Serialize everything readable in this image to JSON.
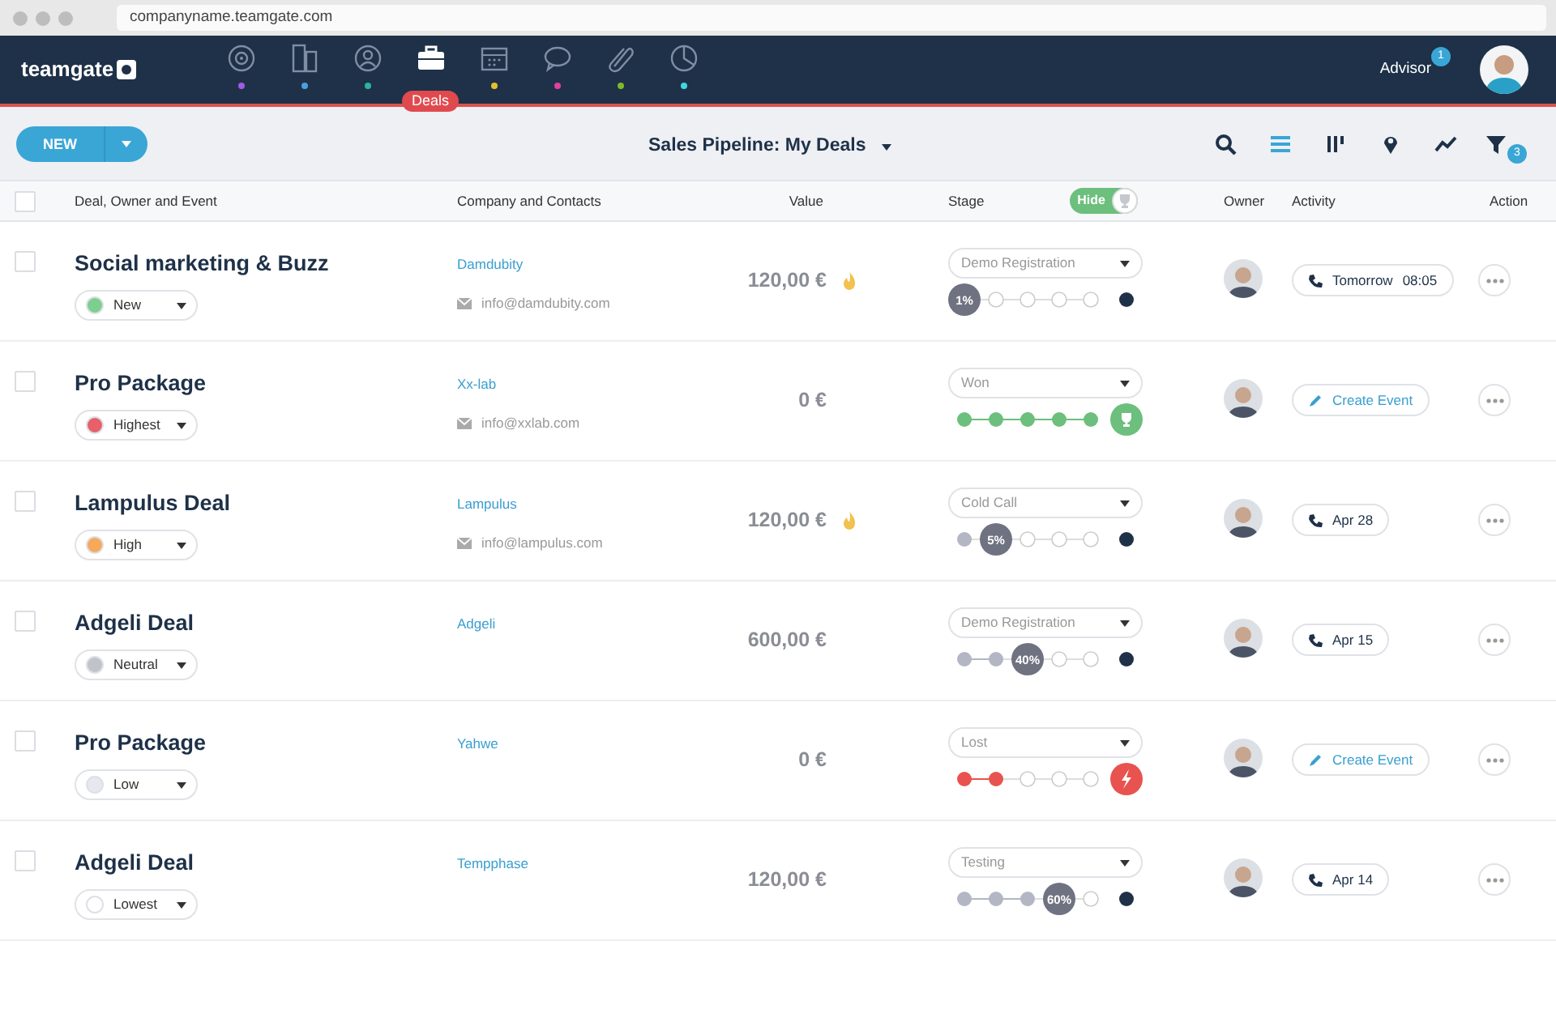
{
  "browser": {
    "url": "companyname.teamgate.com"
  },
  "app": {
    "logo": "teamgate",
    "nav": [
      {
        "selected": false,
        "color": "#a259e6"
      },
      {
        "selected": false,
        "color": "#4a9fdc"
      },
      {
        "selected": false,
        "color": "#2bb39b"
      },
      {
        "selected": true,
        "label": "Deals"
      },
      {
        "selected": false,
        "color": "#e5c02c"
      },
      {
        "selected": false,
        "color": "#e040a0"
      },
      {
        "selected": false,
        "color": "#7fb82a"
      },
      {
        "selected": false,
        "color": "#3fd6e0"
      }
    ],
    "user": {
      "name": "Advisor",
      "badge": "1"
    }
  },
  "toolbar": {
    "new_button": "NEW",
    "title": "Sales Pipeline: My Deals",
    "views": [
      {
        "selected": false
      },
      {
        "selected": true
      },
      {
        "selected": false
      },
      {
        "selected": false
      },
      {
        "selected": false
      },
      {
        "selected": false
      }
    ],
    "filter_badge": "3"
  },
  "table": {
    "select_all": {
      "checked": false
    },
    "columns": [
      "Deal, Owner and Event",
      "Company and Contacts",
      "Value",
      "Stage",
      "Owner",
      "Activity",
      "Action"
    ],
    "hide_toggle": {
      "label": "Hide",
      "on": true
    },
    "rows": [
      {
        "checked": false,
        "title": "Social marketing & Buzz",
        "priority": {
          "label": "New",
          "color": "#7ccf8f"
        },
        "company": "Damdubity",
        "email": "info@damdubity.com",
        "value": "120,00 €",
        "hot": true,
        "stage": {
          "label": "Demo Registration",
          "end": {
            "kind": "open"
          },
          "steps": [
            {
              "current": true
            },
            {
              "done": false,
              "current": false
            },
            {
              "done": false,
              "current": false
            },
            {
              "done": false,
              "current": false
            },
            {
              "done": false,
              "current": false
            }
          ],
          "percent": "1%"
        },
        "activity": {
          "kind": "call",
          "text": "Tomorrow",
          "time": "08:05"
        }
      },
      {
        "checked": false,
        "title": "Pro Package",
        "priority": {
          "label": "Highest",
          "color": "#e8606a"
        },
        "company": "Xx-lab",
        "email": "info@xxlab.com",
        "value": "0 €",
        "hot": false,
        "stage": {
          "label": "Won",
          "end": {
            "kind": "won"
          },
          "steps": [
            {
              "done": true,
              "current": false
            },
            {
              "done": true,
              "current": false
            },
            {
              "done": true,
              "current": false
            },
            {
              "done": true,
              "current": false
            },
            {
              "done": true,
              "current": false
            }
          ]
        },
        "activity": {
          "kind": "create",
          "text": "Create Event"
        }
      },
      {
        "checked": false,
        "title": "Lampulus Deal",
        "priority": {
          "label": "High",
          "color": "#f6a95a"
        },
        "company": "Lampulus",
        "email": "info@lampulus.com",
        "value": "120,00 €",
        "hot": true,
        "stage": {
          "label": "Cold Call",
          "end": {
            "kind": "open"
          },
          "steps": [
            {
              "done": true,
              "current": false
            },
            {
              "current": true
            },
            {
              "done": false,
              "current": false
            },
            {
              "done": false,
              "current": false
            },
            {
              "done": false,
              "current": false
            }
          ],
          "percent": "5%"
        },
        "activity": {
          "kind": "call",
          "text": "Apr 28"
        }
      },
      {
        "checked": false,
        "title": "Adgeli Deal",
        "priority": {
          "label": "Neutral",
          "color": "#c0c3ca"
        },
        "company": "Adgeli",
        "value": "600,00 €",
        "hot": false,
        "stage": {
          "label": "Demo Registration",
          "end": {
            "kind": "open"
          },
          "steps": [
            {
              "done": true,
              "current": false
            },
            {
              "done": true,
              "current": false
            },
            {
              "current": true
            },
            {
              "done": false,
              "current": false
            },
            {
              "done": false,
              "current": false
            }
          ],
          "percent": "40%"
        },
        "activity": {
          "kind": "call",
          "text": "Apr 15"
        }
      },
      {
        "checked": false,
        "title": "Pro Package",
        "priority": {
          "label": "Low",
          "color": "#e6e7ef"
        },
        "company": "Yahwe",
        "value": "0 €",
        "hot": false,
        "stage": {
          "label": "Lost",
          "end": {
            "kind": "lost"
          },
          "steps": [
            {
              "done": true,
              "current": false
            },
            {
              "done": true,
              "current": false
            },
            {
              "done": false,
              "current": false
            },
            {
              "done": false,
              "current": false
            },
            {
              "done": false,
              "current": false
            }
          ]
        },
        "activity": {
          "kind": "create",
          "text": "Create Event"
        }
      },
      {
        "checked": false,
        "title": "Adgeli Deal",
        "priority": {
          "label": "Lowest",
          "color": "#ffffff"
        },
        "company": "Tempphase",
        "value": "120,00 €",
        "hot": false,
        "stage": {
          "label": "Testing",
          "end": {
            "kind": "open"
          },
          "steps": [
            {
              "done": true,
              "current": false
            },
            {
              "done": true,
              "current": false
            },
            {
              "done": true,
              "current": false
            },
            {
              "current": true
            },
            {
              "done": false,
              "current": false
            }
          ],
          "percent": "60%"
        },
        "activity": {
          "kind": "call",
          "text": "Apr 14"
        }
      }
    ]
  }
}
